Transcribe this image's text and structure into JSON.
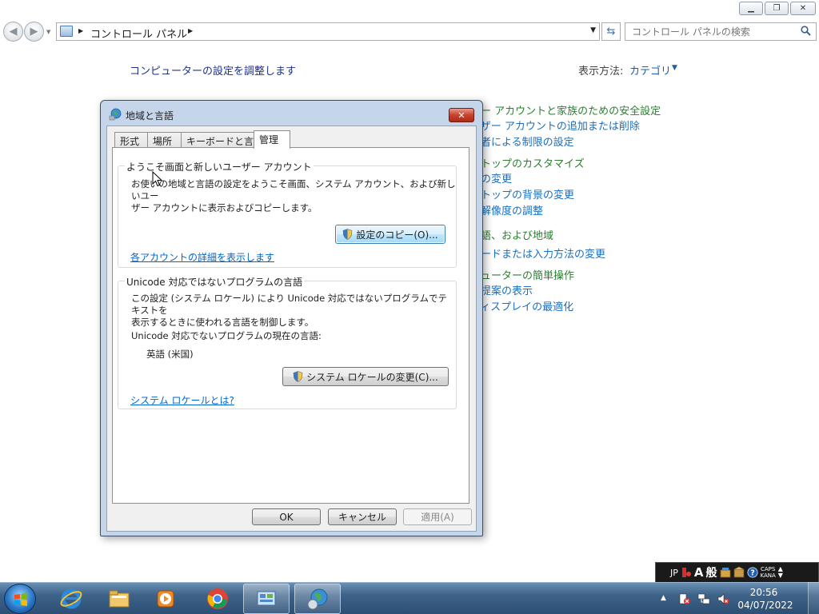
{
  "control_panel": {
    "breadcrumb": "コントロール パネル",
    "search_placeholder": "コントロール パネルの検索",
    "heading": "コンピューターの設定を調整します",
    "view_by_label": "表示方法:",
    "view_by_value": "カテゴリ",
    "links": [
      {
        "text": "ザー アカウントと家族のための安全設定",
        "color": "green"
      },
      {
        "text": "ーザー アカウントの追加または削除",
        "color": "blue"
      },
      {
        "text": "護者による制限の設定",
        "color": "blue"
      },
      {
        "text": "クトップのカスタマイズ",
        "color": "green"
      },
      {
        "text": "マの変更",
        "color": "blue"
      },
      {
        "text": "クトップの背景の変更",
        "color": "blue"
      },
      {
        "text": "の解像度の調整",
        "color": "blue"
      },
      {
        "text": "言語、および地域",
        "color": "green"
      },
      {
        "text": "ボードまたは入力方法の変更",
        "color": "blue"
      },
      {
        "text": "ピューターの簡単操作",
        "color": "green"
      },
      {
        "text": "の提案の表示",
        "color": "blue"
      },
      {
        "text": "ディスプレイの最適化",
        "color": "blue"
      }
    ]
  },
  "dialog": {
    "title": "地域と言語",
    "tabs": [
      "形式",
      "場所",
      "キーボードと言語",
      "管理"
    ],
    "active_tab": "管理",
    "welcome_group": {
      "legend": "ようこそ画面と新しいユーザー アカウント",
      "description_line1": "お使いの地域と言語の設定をようこそ画面、システム アカウント、および新しいユー",
      "description_line2": "ザー アカウントに表示およびコピーします。",
      "copy_button": "設定のコピー(O)...",
      "details_link": "各アカウントの詳細を表示します"
    },
    "unicode_group": {
      "legend": "Unicode 対応ではないプログラムの言語",
      "description_line1": "この設定 (システム ロケール) により Unicode 対応ではないプログラムでテキストを",
      "description_line2": "表示するときに使われる言語を制御します。",
      "current_label": "Unicode 対応でないプログラムの現在の言語:",
      "current_value": "英語 (米国)",
      "change_button": "システム ロケールの変更(C)...",
      "what_link": "システム ロケールとは?"
    },
    "ok_button": "OK",
    "cancel_button": "キャンセル",
    "apply_button": "適用(A)"
  },
  "language_bar": {
    "language": "JP",
    "ime_mode": "A",
    "ime_label": "般",
    "caps_label": "CAPS",
    "kana_label": "KANA"
  },
  "taskbar": {
    "time": "20:56",
    "date": "04/07/2022"
  }
}
